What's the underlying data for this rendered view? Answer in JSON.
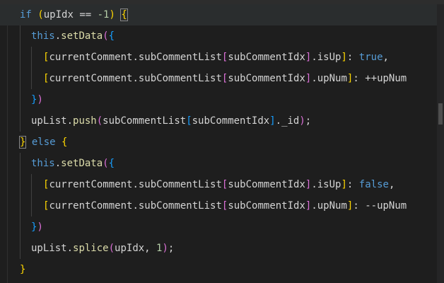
{
  "editor": {
    "lines": [
      {
        "tokens": [
          {
            "t": "if",
            "c": "kw"
          },
          {
            "t": " ",
            "c": "plain"
          },
          {
            "t": "(",
            "c": "pl1"
          },
          {
            "t": "upIdx",
            "c": "plain"
          },
          {
            "t": " == ",
            "c": "op"
          },
          {
            "t": "-1",
            "c": "num"
          },
          {
            "t": ")",
            "c": "pl1"
          },
          {
            "t": " ",
            "c": "plain"
          },
          {
            "t": "{",
            "c": "pl1"
          }
        ]
      },
      {
        "tokens": [
          {
            "t": "this",
            "c": "this"
          },
          {
            "t": ".",
            "c": "plain"
          },
          {
            "t": "setData",
            "c": "fn"
          },
          {
            "t": "(",
            "c": "pl2"
          },
          {
            "t": "{",
            "c": "pl3"
          }
        ]
      },
      {
        "tokens": [
          {
            "t": "[",
            "c": "pl1"
          },
          {
            "t": "currentComment.subCommentList",
            "c": "plain"
          },
          {
            "t": "[",
            "c": "pl2"
          },
          {
            "t": "subCommentIdx",
            "c": "plain"
          },
          {
            "t": "]",
            "c": "pl2"
          },
          {
            "t": ".isUp",
            "c": "plain"
          },
          {
            "t": "]",
            "c": "pl1"
          },
          {
            "t": ": ",
            "c": "plain"
          },
          {
            "t": "true",
            "c": "bool"
          },
          {
            "t": ",",
            "c": "plain"
          }
        ]
      },
      {
        "tokens": [
          {
            "t": "[",
            "c": "pl1"
          },
          {
            "t": "currentComment.subCommentList",
            "c": "plain"
          },
          {
            "t": "[",
            "c": "pl2"
          },
          {
            "t": "subCommentIdx",
            "c": "plain"
          },
          {
            "t": "]",
            "c": "pl2"
          },
          {
            "t": ".upNum",
            "c": "plain"
          },
          {
            "t": "]",
            "c": "pl1"
          },
          {
            "t": ": ",
            "c": "plain"
          },
          {
            "t": "++",
            "c": "op"
          },
          {
            "t": "upNum",
            "c": "plain"
          }
        ]
      },
      {
        "tokens": [
          {
            "t": "}",
            "c": "pl3"
          },
          {
            "t": ")",
            "c": "pl2"
          }
        ]
      },
      {
        "tokens": [
          {
            "t": "upList",
            "c": "plain"
          },
          {
            "t": ".",
            "c": "plain"
          },
          {
            "t": "push",
            "c": "fn"
          },
          {
            "t": "(",
            "c": "pl2"
          },
          {
            "t": "subCommentList",
            "c": "plain"
          },
          {
            "t": "[",
            "c": "pl3"
          },
          {
            "t": "subCommentIdx",
            "c": "plain"
          },
          {
            "t": "]",
            "c": "pl3"
          },
          {
            "t": "._id",
            "c": "plain"
          },
          {
            "t": ")",
            "c": "pl2"
          },
          {
            "t": ";",
            "c": "plain"
          }
        ]
      },
      {
        "tokens": [
          {
            "t": "}",
            "c": "pl1"
          },
          {
            "t": " ",
            "c": "plain"
          },
          {
            "t": "else",
            "c": "kw"
          },
          {
            "t": " ",
            "c": "plain"
          },
          {
            "t": "{",
            "c": "pl1"
          }
        ]
      },
      {
        "tokens": [
          {
            "t": "this",
            "c": "this"
          },
          {
            "t": ".",
            "c": "plain"
          },
          {
            "t": "setData",
            "c": "fn"
          },
          {
            "t": "(",
            "c": "pl2"
          },
          {
            "t": "{",
            "c": "pl3"
          }
        ]
      },
      {
        "tokens": [
          {
            "t": "[",
            "c": "pl1"
          },
          {
            "t": "currentComment.subCommentList",
            "c": "plain"
          },
          {
            "t": "[",
            "c": "pl2"
          },
          {
            "t": "subCommentIdx",
            "c": "plain"
          },
          {
            "t": "]",
            "c": "pl2"
          },
          {
            "t": ".isUp",
            "c": "plain"
          },
          {
            "t": "]",
            "c": "pl1"
          },
          {
            "t": ": ",
            "c": "plain"
          },
          {
            "t": "false",
            "c": "bool"
          },
          {
            "t": ",",
            "c": "plain"
          }
        ]
      },
      {
        "tokens": [
          {
            "t": "[",
            "c": "pl1"
          },
          {
            "t": "currentComment.subCommentList",
            "c": "plain"
          },
          {
            "t": "[",
            "c": "pl2"
          },
          {
            "t": "subCommentIdx",
            "c": "plain"
          },
          {
            "t": "]",
            "c": "pl2"
          },
          {
            "t": ".upNum",
            "c": "plain"
          },
          {
            "t": "]",
            "c": "pl1"
          },
          {
            "t": ": ",
            "c": "plain"
          },
          {
            "t": "--",
            "c": "op"
          },
          {
            "t": "upNum",
            "c": "plain"
          }
        ]
      },
      {
        "tokens": [
          {
            "t": "}",
            "c": "pl3"
          },
          {
            "t": ")",
            "c": "pl2"
          }
        ]
      },
      {
        "tokens": [
          {
            "t": "upList",
            "c": "plain"
          },
          {
            "t": ".",
            "c": "plain"
          },
          {
            "t": "splice",
            "c": "fn"
          },
          {
            "t": "(",
            "c": "pl2"
          },
          {
            "t": "upIdx, ",
            "c": "plain"
          },
          {
            "t": "1",
            "c": "num"
          },
          {
            "t": ")",
            "c": "pl2"
          },
          {
            "t": ";",
            "c": "plain"
          }
        ]
      },
      {
        "tokens": [
          {
            "t": "}",
            "c": "pl1"
          }
        ]
      }
    ]
  },
  "theme": {
    "background": "#1e1e1e",
    "keyword": "#569cd6",
    "function": "#dcdcaa",
    "number": "#b5cea8",
    "bracket_level_1": "#ffd700",
    "bracket_level_2": "#da70d6",
    "bracket_level_3": "#179fff"
  }
}
